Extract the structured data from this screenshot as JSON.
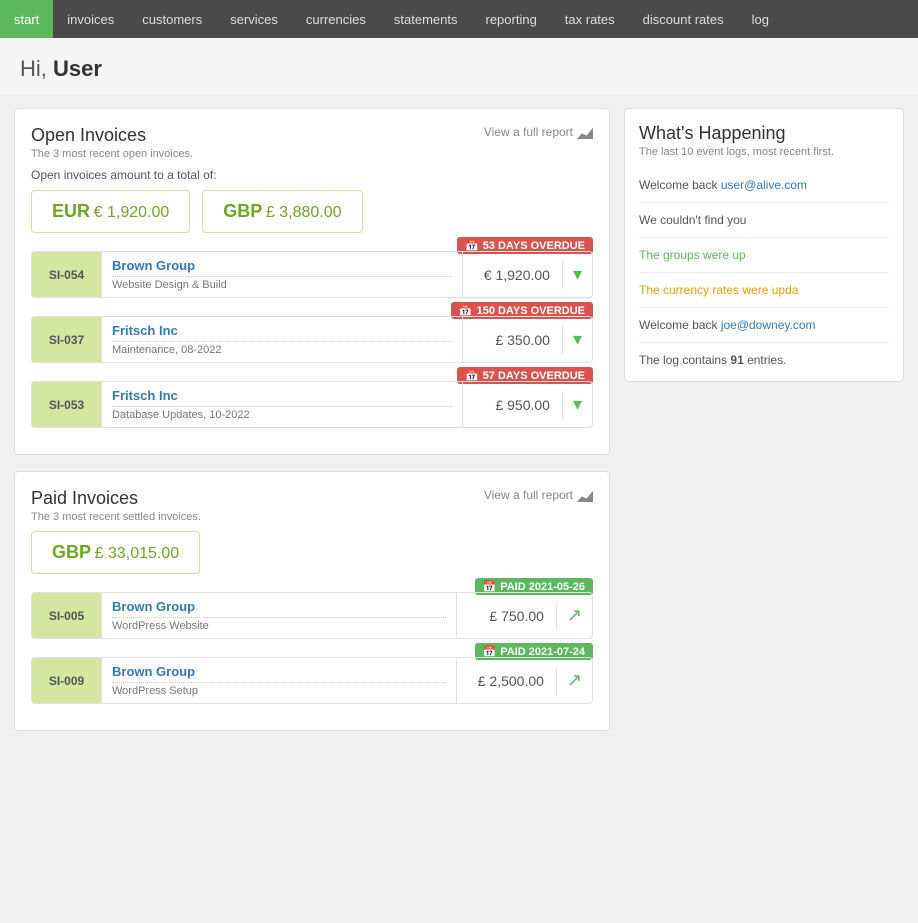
{
  "nav": {
    "items": [
      {
        "label": "start",
        "active": true
      },
      {
        "label": "invoices",
        "active": false
      },
      {
        "label": "customers",
        "active": false
      },
      {
        "label": "services",
        "active": false
      },
      {
        "label": "currencies",
        "active": false
      },
      {
        "label": "statements",
        "active": false
      },
      {
        "label": "reporting",
        "active": false
      },
      {
        "label": "tax rates",
        "active": false
      },
      {
        "label": "discount rates",
        "active": false
      },
      {
        "label": "log",
        "active": false
      }
    ]
  },
  "greeting": {
    "prefix": "Hi, ",
    "username": "User"
  },
  "open_invoices": {
    "title": "Open Invoices",
    "subtitle": "The 3 most recent open invoices.",
    "view_report": "View a full report",
    "total_label": "Open invoices amount to a total of:",
    "currencies": [
      {
        "code": "EUR",
        "symbol": "€",
        "amount": "1,920.00"
      },
      {
        "code": "GBP",
        "symbol": "£",
        "amount": "3,880.00"
      }
    ],
    "items": [
      {
        "id": "SI-054",
        "client": "Brown Group",
        "description": "Website Design & Build",
        "amount": "€ 1,920.00",
        "badge_type": "overdue",
        "badge_text": "53 DAYS OVERDUE"
      },
      {
        "id": "SI-037",
        "client": "Fritsch Inc",
        "description": "Maintenance, 08-2022",
        "amount": "£ 350.00",
        "badge_type": "overdue",
        "badge_text": "150 DAYS OVERDUE"
      },
      {
        "id": "SI-053",
        "client": "Fritsch Inc",
        "description": "Database Updates, 10-2022",
        "amount": "£ 950.00",
        "badge_type": "overdue",
        "badge_text": "57 DAYS OVERDUE"
      }
    ]
  },
  "paid_invoices": {
    "title": "Paid Invoices",
    "subtitle": "The 3 most recent settled invoices.",
    "view_report": "View a full report",
    "currencies": [
      {
        "code": "GBP",
        "symbol": "£",
        "amount": "33,015.00"
      }
    ],
    "items": [
      {
        "id": "SI-005",
        "client": "Brown Group",
        "description": "WordPress Website",
        "amount": "£ 750.00",
        "badge_type": "paid",
        "badge_text": "PAID 2021-05-26"
      },
      {
        "id": "SI-009",
        "client": "Brown Group",
        "description": "WordPress Setup",
        "amount": "£ 2,500.00",
        "badge_type": "paid",
        "badge_text": "PAID 2021-07-24"
      }
    ]
  },
  "whats_happening": {
    "title": "What's Happening",
    "subtitle": "The last 10 event logs, most recent first.",
    "events": [
      {
        "text": "Welcome back ",
        "link": "user@alive.com",
        "link_color": "blue",
        "rest": ""
      },
      {
        "text": "We couldn't find you",
        "link": "",
        "link_color": "",
        "rest": ""
      },
      {
        "text": "The groups were up",
        "link": "",
        "link_color": "green",
        "rest": ""
      },
      {
        "text": "The currency rates were upda",
        "link": "",
        "link_color": "orange",
        "rest": ""
      },
      {
        "text": "Welcome back ",
        "link": "joe@downey.com",
        "link_color": "blue",
        "rest": ""
      }
    ],
    "log_prefix": "The log contains ",
    "log_count": "91",
    "log_suffix": " entries."
  }
}
